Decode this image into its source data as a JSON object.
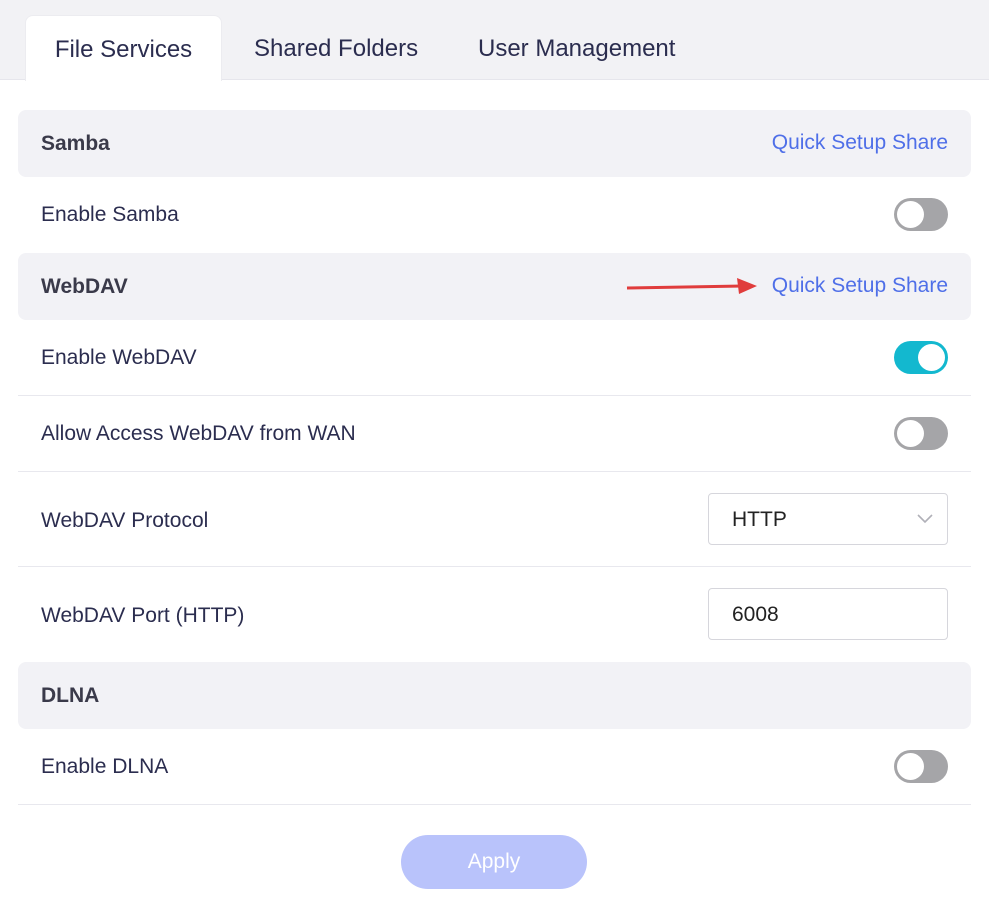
{
  "tabs": [
    {
      "label": "File Services",
      "active": true
    },
    {
      "label": "Shared Folders",
      "active": false
    },
    {
      "label": "User Management",
      "active": false
    }
  ],
  "samba": {
    "title": "Samba",
    "link": "Quick Setup Share",
    "enable_label": "Enable Samba",
    "enable_on": false
  },
  "webdav": {
    "title": "WebDAV",
    "link": "Quick Setup Share",
    "enable_label": "Enable WebDAV",
    "enable_on": true,
    "wan_label": "Allow Access WebDAV from WAN",
    "wan_on": false,
    "protocol_label": "WebDAV Protocol",
    "protocol_value": "HTTP",
    "port_label": "WebDAV Port (HTTP)",
    "port_value": "6008"
  },
  "dlna": {
    "title": "DLNA",
    "enable_label": "Enable DLNA",
    "enable_on": false
  },
  "apply_label": "Apply",
  "colors": {
    "accent_link": "#4f6fe8",
    "toggle_on": "#13b8cf",
    "toggle_off": "#a5a5a8",
    "apply_bg": "#b9c3fb",
    "annotation_arrow": "#e03c3c"
  }
}
